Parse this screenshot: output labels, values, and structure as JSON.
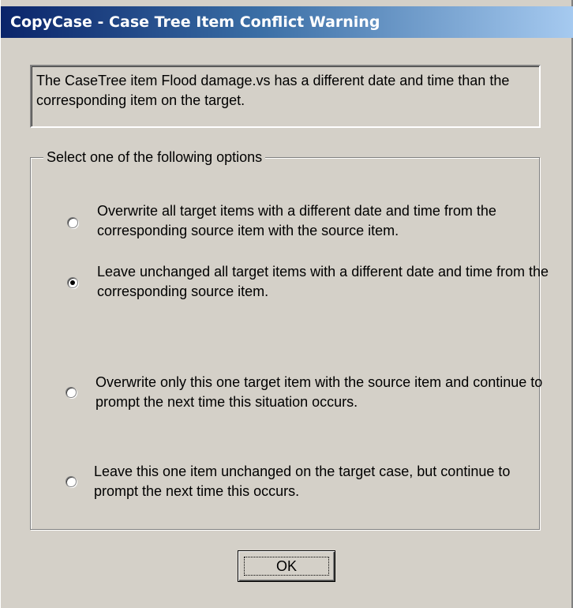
{
  "dialog": {
    "title": "CopyCase - Case Tree Item Conflict Warning",
    "message": "The CaseTree item Flood damage.vs has a different date and time than the corresponding item on the target.",
    "group_label": "Select one of the following options",
    "options": [
      {
        "label": "Overwrite all target items with a different date and time from the corresponding source item with the source item.",
        "selected": false
      },
      {
        "label": "Leave unchanged all target items with a different date and time from the corresponding source item.",
        "selected": true
      },
      {
        "label": "Overwrite only this one target item with the source item and continue to prompt the next time this situation occurs.",
        "selected": false
      },
      {
        "label": "Leave this one item unchanged on the target case, but continue to prompt the next time this occurs.",
        "selected": false
      }
    ],
    "ok_label": "OK"
  }
}
